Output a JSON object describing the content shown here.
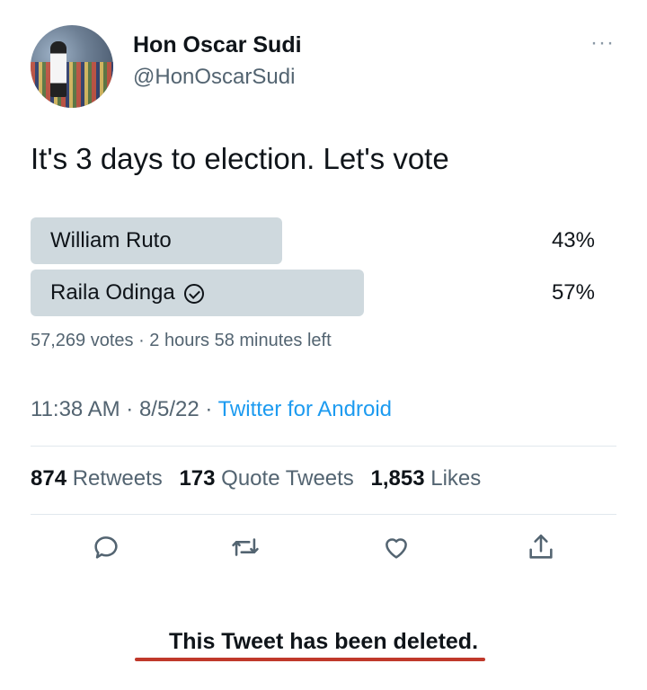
{
  "author": {
    "name": "Hon Oscar Sudi",
    "handle": "@HonOscarSudi",
    "more_icon": "more-horizontal-icon"
  },
  "tweet": {
    "text": "It's 3 days to election. Let's vote"
  },
  "poll": {
    "options": [
      {
        "label": "William Ruto",
        "percent_text": "43%",
        "percent": 43,
        "selected": false
      },
      {
        "label": "Raila Odinga",
        "percent_text": "57%",
        "percent": 57,
        "selected": true
      }
    ],
    "meta": "57,269 votes · 2 hours 58 minutes left",
    "bar_color": "#cfd9de"
  },
  "timestamp": {
    "time_date": "11:38 AM · 8/5/22 · ",
    "source": "Twitter for Android"
  },
  "stats": {
    "retweets_count": "874",
    "retweets_label": "Retweets",
    "quotes_count": "173",
    "quotes_label": "Quote Tweets",
    "likes_count": "1,853",
    "likes_label": "Likes"
  },
  "actions": [
    "reply-icon",
    "retweet-icon",
    "like-icon",
    "share-icon"
  ],
  "notice": {
    "text": "This Tweet has been deleted.",
    "underline_color": "#c0392b"
  },
  "colors": {
    "link": "#1d9bf0",
    "muted": "#536471"
  }
}
